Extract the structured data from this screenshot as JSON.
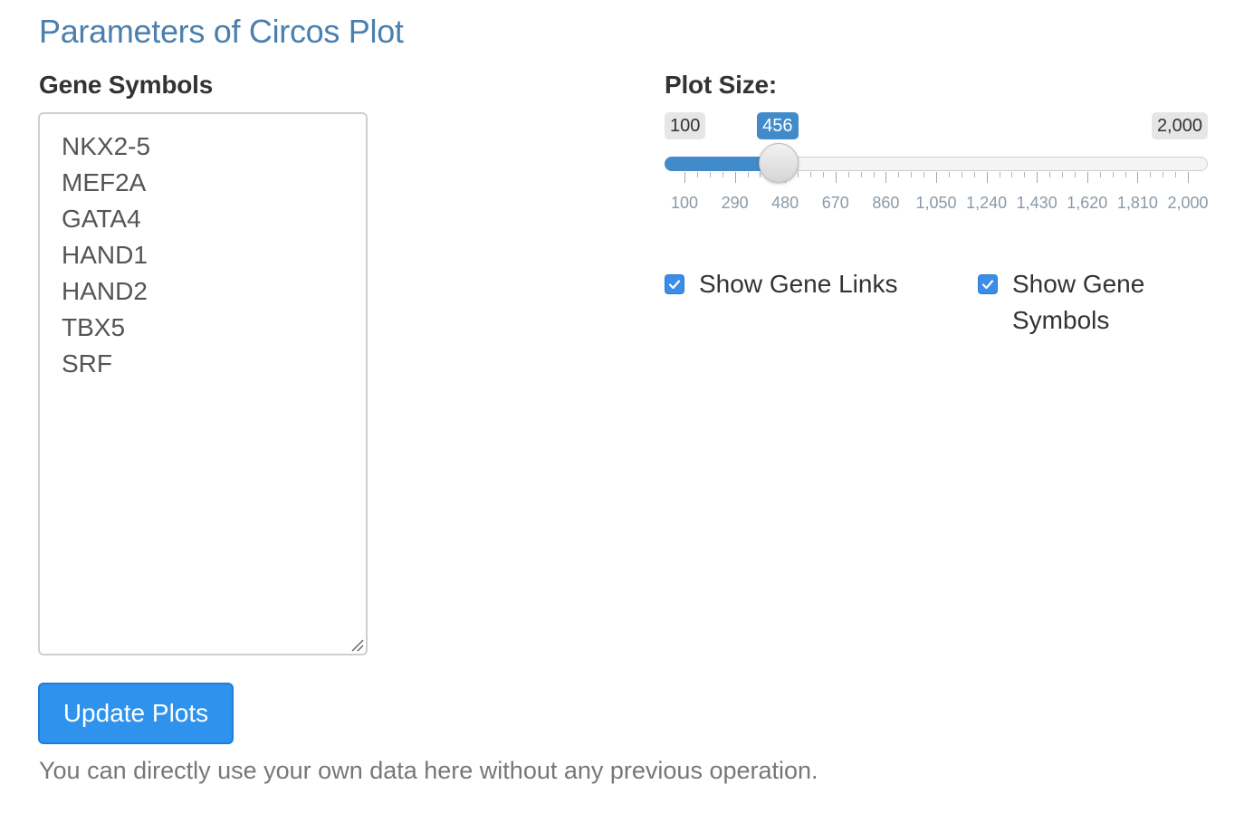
{
  "title": "Parameters of Circos Plot",
  "gene_symbols": {
    "label": "Gene Symbols",
    "value": "NKX2-5\nMEF2A\nGATA4\nHAND1\nHAND2\nTBX5\nSRF"
  },
  "plot_size": {
    "label": "Plot Size:",
    "min_label": "100",
    "max_label": "2,000",
    "current_label": "456",
    "min": 100,
    "max": 2000,
    "value": 456,
    "tick_labels": [
      "100",
      "290",
      "480",
      "670",
      "860",
      "1,050",
      "1,240",
      "1,430",
      "1,620",
      "1,810",
      "2,000"
    ],
    "fill_color": "#428bca"
  },
  "checkboxes": {
    "show_gene_links": {
      "label": "Show Gene Links",
      "checked": true
    },
    "show_gene_symbols": {
      "label": "Show Gene Symbols",
      "checked": true
    }
  },
  "update_button": {
    "label": "Update Plots",
    "color": "#2f93ee"
  },
  "helper_text": "You can directly use your own data here without any previous operation.",
  "colors": {
    "title": "#4a7fae",
    "accent": "#428bca"
  }
}
